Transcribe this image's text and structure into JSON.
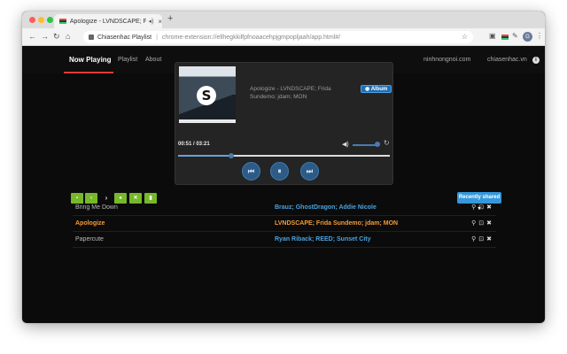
{
  "browser": {
    "tab_title": "Apologize - LVNDSCAPE; F",
    "new_tab": "+",
    "omnibox_label": "Chiasenhac Playlist",
    "omnibox_url": "chrome-extension://ellhegkkilfpfnoaacehpjgmpopljaah/app.html#/",
    "profile_initial": "G"
  },
  "nav": {
    "now_playing": "Now Playing",
    "playlist": "Playlist",
    "about": "About",
    "link1": "ninhnongnoi.com",
    "link2": "chiasenhac.vn",
    "info": "i"
  },
  "player": {
    "cover_logo": "S",
    "track": "Apologize - LVNDSCAPE; Frida Sundemo; jdam; MON",
    "album_label": "Album",
    "current_time": "00:51",
    "duration": "03:21",
    "time_text": "00:51 / 03:21",
    "progress_fraction": 0.253,
    "volume_fraction": 1.0
  },
  "toolbar": {
    "recently_shared": "Recently shared ▾"
  },
  "songs": [
    {
      "title": "Bring Me Down",
      "artist": "Brauz; GhostDragon; Addie Nicole",
      "current": false
    },
    {
      "title": "Apologize",
      "artist": "LVNDSCAPE; Frida Sundemo; jdam; MON",
      "current": true
    },
    {
      "title": "Papercute",
      "artist": "Ryan Riback; REED; Sunset City",
      "current": false
    }
  ],
  "icons": {
    "accent_red": "#e53935",
    "accent_blue": "#3498db",
    "accent_green": "#76b82a",
    "current_orange": "#f39c38"
  }
}
